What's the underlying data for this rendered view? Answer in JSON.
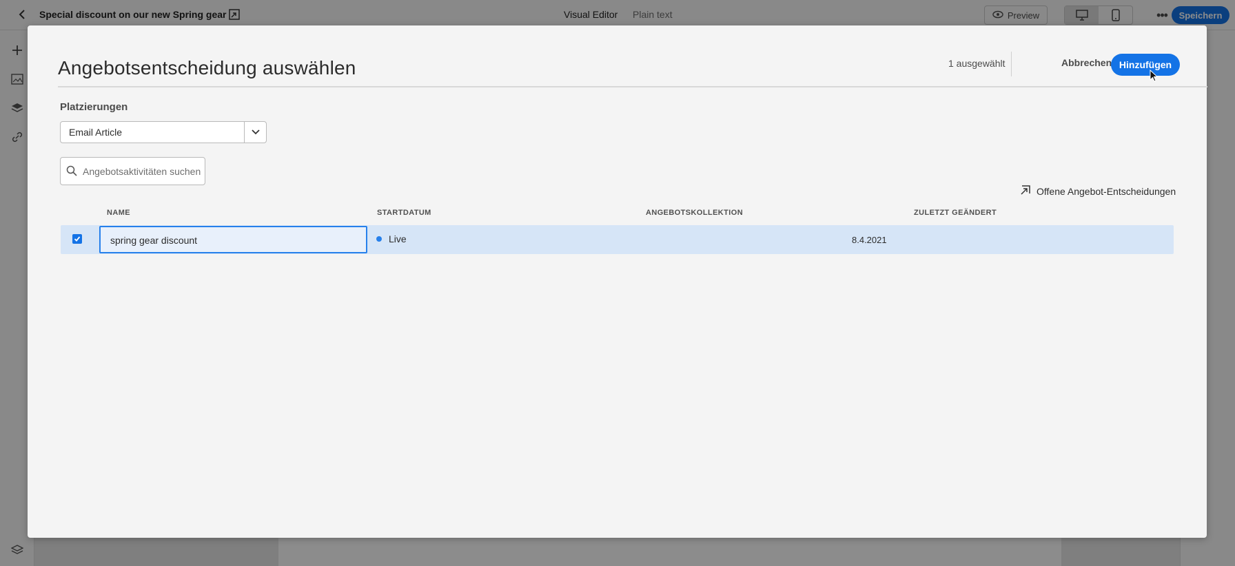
{
  "editor": {
    "title": "Special discount on our new Spring gear",
    "tabs": [
      "Visual Editor",
      "Plain text"
    ],
    "preview_label": "Preview",
    "save_label": "Speichern"
  },
  "dialog": {
    "title": "Angebotsentscheidung auswählen",
    "selected_count": "1 ausgewählt",
    "cancel_label": "Abbrechen",
    "add_label": "Hinzufügen",
    "placements_label": "Platzierungen",
    "placement_value": "Email Article",
    "search_placeholder": "Angebotsaktivitäten suchen",
    "open_link_label": "Offene Angebot-Entscheidungen",
    "columns": [
      "NAME",
      "STARTDATUM",
      "ANGEBOTSKOLLEKTION",
      "ZULETZT GEÄNDERT"
    ],
    "rows": [
      {
        "name": "spring gear discount",
        "status": "Live",
        "collection": "",
        "modified": "8.4.2021",
        "selected": true
      }
    ]
  },
  "colors": {
    "accent": "#1473e6",
    "row_selected": "#d6e5f7",
    "status_live": "#2680eb"
  },
  "icons": [
    "chevron-left-icon",
    "open-in-icon",
    "eye-icon",
    "desktop-icon",
    "mobile-icon",
    "more-icon",
    "plus-icon",
    "image-icon",
    "layers-icon",
    "link-icon",
    "search-icon",
    "chevron-down-icon",
    "checkbox-checked-icon",
    "cursor-icon"
  ]
}
